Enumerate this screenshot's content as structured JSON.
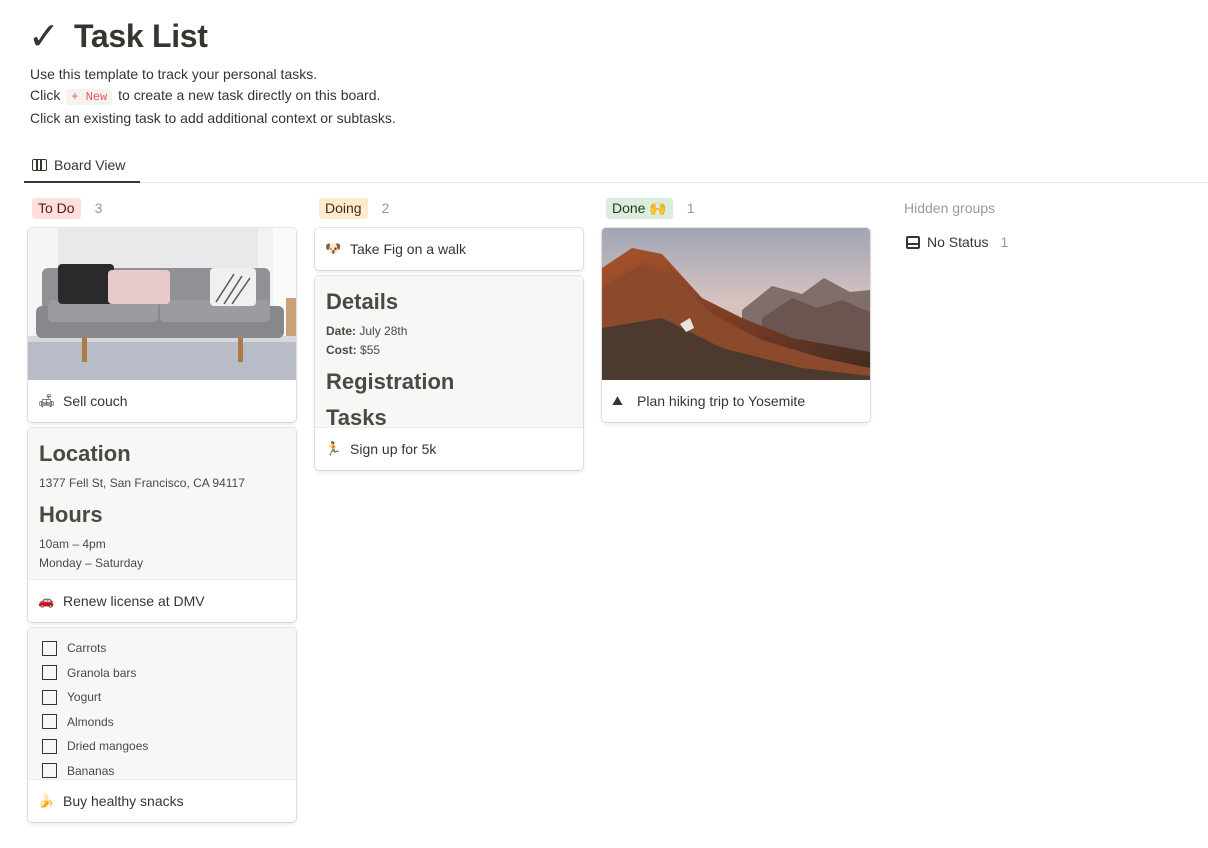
{
  "page": {
    "title": "Task List",
    "description": {
      "line1": "Use this template to track your personal tasks.",
      "line2_before": "Click",
      "line2_code": "+ New",
      "line2_after": "to create a new task directly on this board.",
      "line3": "Click an existing task to add additional context or subtasks."
    }
  },
  "tabs": [
    {
      "label": "Board View",
      "icon": "board-icon"
    }
  ],
  "colors": {
    "todo_pill_bg": "#fddfdc",
    "todo_pill_fg": "#5d1715",
    "doing_pill_bg": "#fbeccc",
    "doing_pill_fg": "#402c1b",
    "done_pill_bg": "#dbeddb",
    "done_pill_fg": "#1c3829"
  },
  "columns": {
    "todo": {
      "label": "To Do",
      "count": "3",
      "cards": [
        {
          "title": "Sell couch",
          "emoji": "🛋",
          "cover": "couch-photo"
        },
        {
          "title": "Renew license at DMV",
          "emoji": "🚗",
          "preview": {
            "h1": "Location",
            "address": "1377 Fell St, San Francisco, CA 94117",
            "h2": "Hours",
            "hours": "10am – 4pm",
            "days": "Monday – Saturday"
          }
        },
        {
          "title": "Buy healthy snacks",
          "emoji": "🍌",
          "checklist": [
            "Carrots",
            "Granola bars",
            "Yogurt",
            "Almonds",
            "Dried mangoes",
            "Bananas"
          ]
        }
      ]
    },
    "doing": {
      "label": "Doing",
      "count": "2",
      "cards": [
        {
          "title": "Take Fig on a walk",
          "emoji": "🐶"
        },
        {
          "title": "Sign up for 5k",
          "emoji": "🏃",
          "preview": {
            "h1": "Details",
            "date_label": "Date:",
            "date_value": "July 28th",
            "cost_label": "Cost:",
            "cost_value": "$55",
            "h2": "Registration",
            "h3": "Tasks"
          }
        }
      ]
    },
    "done": {
      "label": "Done 🙌",
      "count": "1",
      "cards": [
        {
          "title": "Plan hiking trip to Yosemite",
          "emoji": "⛰",
          "cover": "mountain-photo"
        }
      ]
    }
  },
  "hidden_groups": {
    "label": "Hidden groups",
    "items": [
      {
        "label": "No Status",
        "count": "1",
        "icon": "inbox-icon"
      }
    ]
  }
}
